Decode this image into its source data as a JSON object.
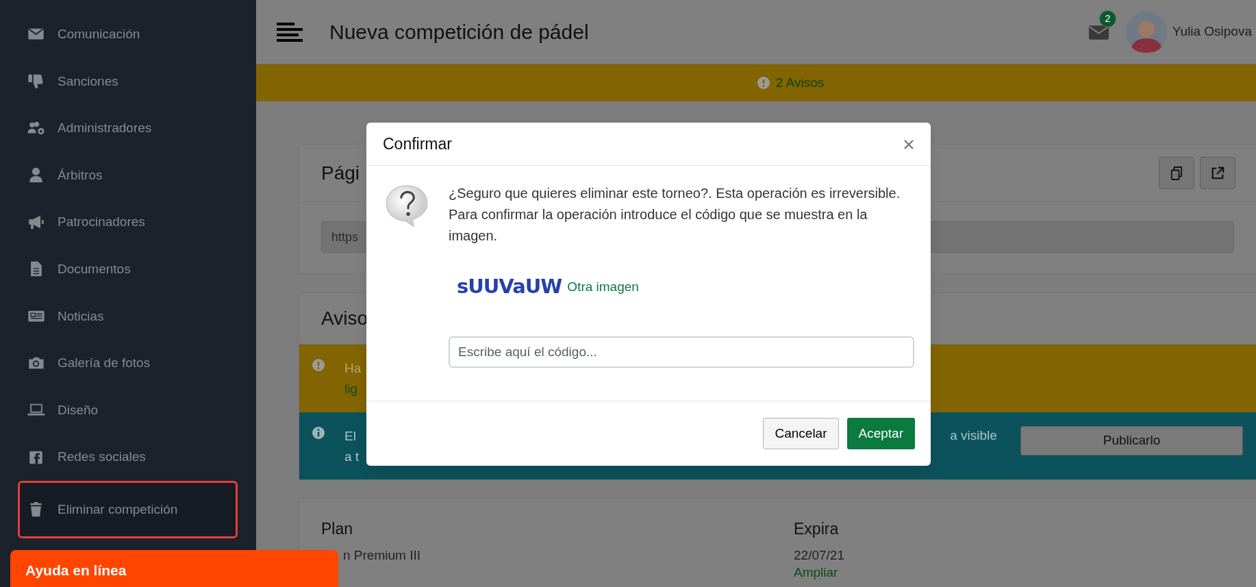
{
  "sidebar": {
    "items": [
      {
        "label": "Comunicación",
        "highlighted": false
      },
      {
        "label": "Sanciones",
        "highlighted": false
      },
      {
        "label": "Administradores",
        "highlighted": false
      },
      {
        "label": "Árbitros",
        "highlighted": false
      },
      {
        "label": "Patrocinadores",
        "highlighted": false
      },
      {
        "label": "Documentos",
        "highlighted": false
      },
      {
        "label": "Noticias",
        "highlighted": false
      },
      {
        "label": "Galería de fotos",
        "highlighted": false
      },
      {
        "label": "Diseño",
        "highlighted": false
      },
      {
        "label": "Redes sociales",
        "highlighted": false
      },
      {
        "label": "Eliminar competición",
        "highlighted": true
      }
    ]
  },
  "topbar": {
    "title": "Nueva competición de pádel",
    "mail_badge": "2",
    "user_name": "Yulia Osipova"
  },
  "warning_bar": {
    "text": "2 Avisos"
  },
  "page_card": {
    "title": "Pági",
    "url_field": {
      "value": "https"
    }
  },
  "notices_card": {
    "title": "Aviso",
    "alerts": [
      {
        "kind": "warning",
        "text": "Ha",
        "link": "lig"
      },
      {
        "kind": "info",
        "text": "El",
        "text_2": "a t",
        "text_right": "a visible",
        "button": "Publicarlo"
      }
    ]
  },
  "plan_card": {
    "columns": [
      {
        "heading": "Plan",
        "value": "n Premium III"
      },
      {
        "heading": "Expira",
        "value": "22/07/21",
        "link": "Ampliar"
      }
    ]
  },
  "help_widget": {
    "label": "Ayuda en línea"
  },
  "modal": {
    "title": "Confirmar",
    "message": "¿Seguro que quieres eliminar este torneo?. Esta operación es irreversible. Para confirmar la operación introduce el código que se muestra en la imagen.",
    "captcha": "sUUVaUW",
    "captcha_link": "Otra imagen",
    "code_field": {
      "placeholder": "Escribe aquí el código..."
    },
    "buttons": [
      {
        "label": "Cancelar",
        "kind": "secondary"
      },
      {
        "label": "Aceptar",
        "kind": "primary"
      }
    ]
  }
}
